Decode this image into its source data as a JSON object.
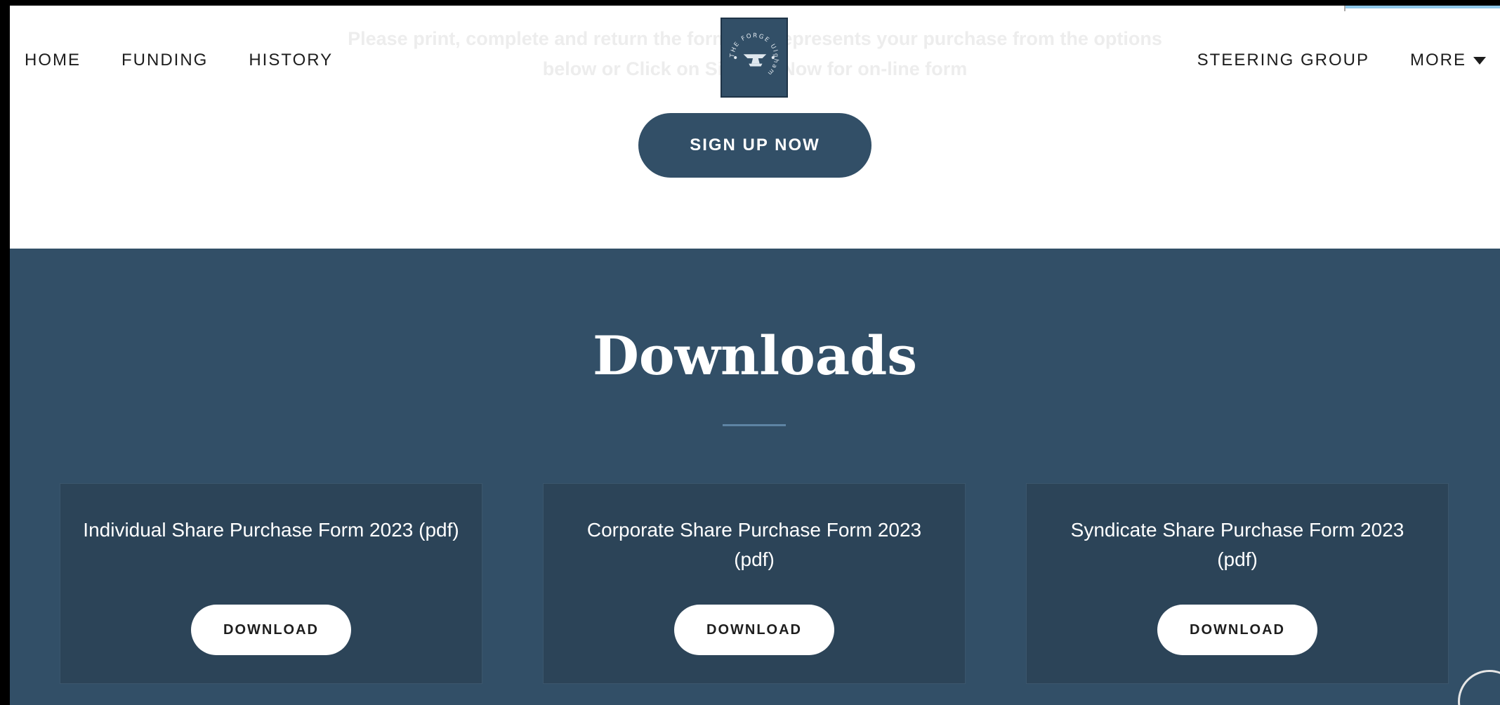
{
  "nav": {
    "left": [
      "HOME",
      "FUNDING",
      "HISTORY"
    ],
    "right": [
      "STEERING GROUP",
      "MORE"
    ]
  },
  "logo": {
    "text": "THE FORGE Ulgham"
  },
  "intro": {
    "line1": "Please print, complete and return the form that represents your purchase from the options",
    "line2": "below or Click on Sign Up Now for on-line form"
  },
  "signup": {
    "label": "SIGN UP NOW"
  },
  "downloads": {
    "title": "Downloads",
    "cards": [
      {
        "title": "Individual Share Purchase Form 2023 (pdf)",
        "button": "DOWNLOAD"
      },
      {
        "title": "Corporate Share Purchase Form 2023 (pdf)",
        "button": "DOWNLOAD"
      },
      {
        "title": "Syndicate Share Purchase Form 2023 (pdf)",
        "button": "DOWNLOAD"
      }
    ]
  },
  "colors": {
    "brand": "#324f67",
    "card": "#2c4458",
    "divider": "#5e84a4"
  }
}
